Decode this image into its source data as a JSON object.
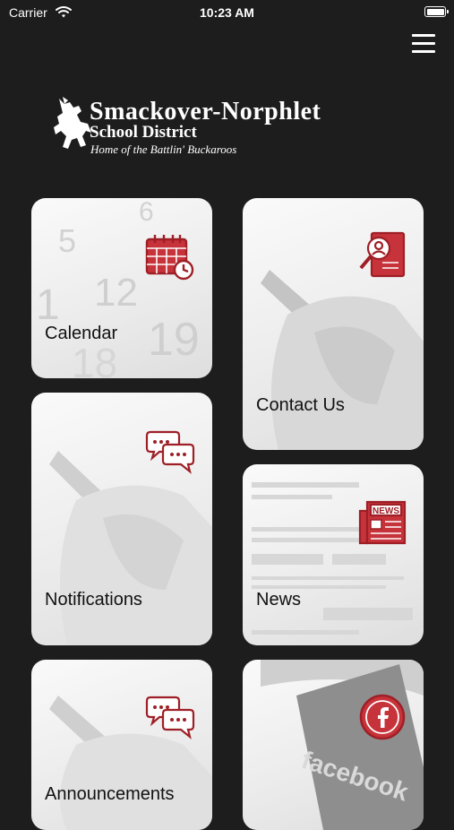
{
  "status_bar": {
    "carrier": "Carrier",
    "time": "10:23 AM"
  },
  "header": {
    "menu_icon": "hamburger-menu-icon"
  },
  "logo": {
    "line1": "Smackover-Norphlet",
    "line2": "School District",
    "line3": "Home of the Battlin' Buckaroos"
  },
  "tiles": [
    {
      "label": "Calendar",
      "icon": "calendar-clock-icon"
    },
    {
      "label": "Contact Us",
      "icon": "contact-search-icon"
    },
    {
      "label": "Notifications",
      "icon": "chat-bubbles-icon"
    },
    {
      "label": "News",
      "icon": "newspaper-icon",
      "icon_text": "NEWS"
    },
    {
      "label": "Announcements",
      "icon": "chat-bubbles-icon"
    },
    {
      "label": "",
      "icon": "facebook-icon",
      "background_text": "facebook"
    }
  ],
  "colors": {
    "background": "#1d1d1d",
    "accent": "#b5232b",
    "tile": "#ececec",
    "label": "#111111"
  }
}
